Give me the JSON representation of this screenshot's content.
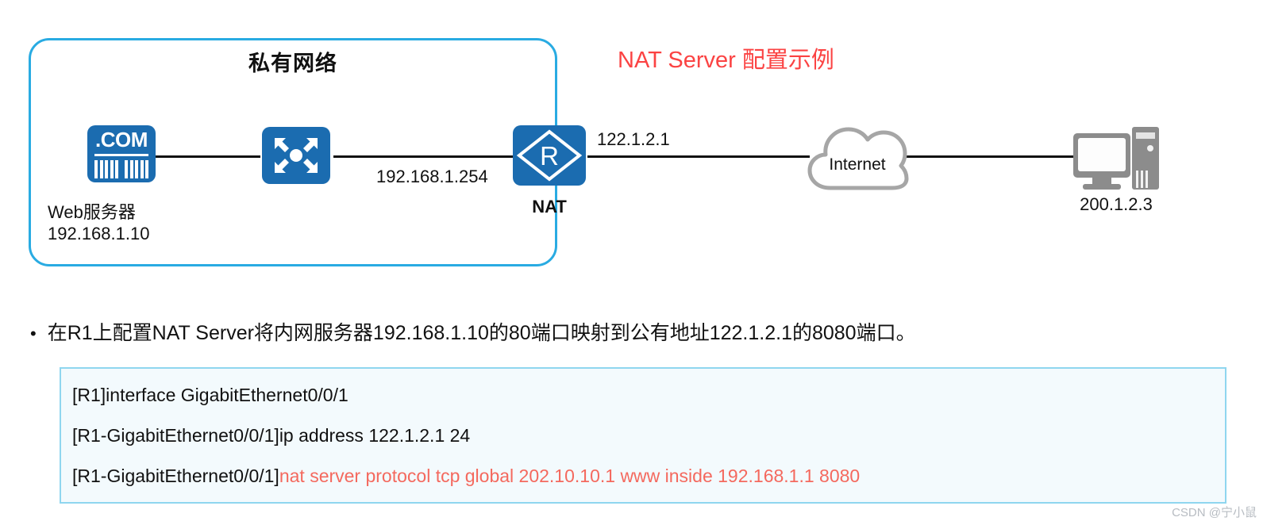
{
  "diagram": {
    "private_zone_title": "私有网络",
    "headline": "NAT Server 配置示例",
    "nodes": {
      "web_server": {
        "icon": "server-dotcom-icon",
        "badge": ".COM",
        "label": "Web服务器",
        "ip": "192.168.1.10"
      },
      "switch": {
        "icon": "switch-icon"
      },
      "router": {
        "icon": "router-icon",
        "glyph": "R",
        "label": "NAT"
      },
      "internet": {
        "icon": "cloud-icon",
        "label": "Internet"
      },
      "client_pc": {
        "icon": "desktop-computer-icon",
        "ip": "200.1.2.3"
      }
    },
    "link_labels": {
      "inside_gateway_ip": "192.168.1.254",
      "outside_ip": "122.1.2.1"
    }
  },
  "bullet": {
    "marker": "•",
    "text": "在R1上配置NAT Server将内网服务器192.168.1.10的80端口映射到公有地址122.1.2.1的8080端口。"
  },
  "config": {
    "lines": [
      {
        "prompt": "[R1]interface GigabitEthernet0/0/1",
        "command": ""
      },
      {
        "prompt": "[R1-GigabitEthernet0/0/1]ip address 122.1.2.1 24",
        "command": ""
      },
      {
        "prompt": "[R1-GigabitEthernet0/0/1]",
        "command": "nat server protocol tcp global 202.10.10.1 www inside 192.168.1.1 8080"
      }
    ]
  },
  "watermark": "CSDN @宁小鼠",
  "colors": {
    "zone_border": "#29abe2",
    "device_blue": "#1b6cb0",
    "headline_red": "#fb4343",
    "command_red": "#f4695e",
    "code_border": "#8fd6ef",
    "code_bg": "#f3fafd",
    "cloud_gray": "#a6a6a6",
    "pc_gray": "#8c8c8c"
  }
}
